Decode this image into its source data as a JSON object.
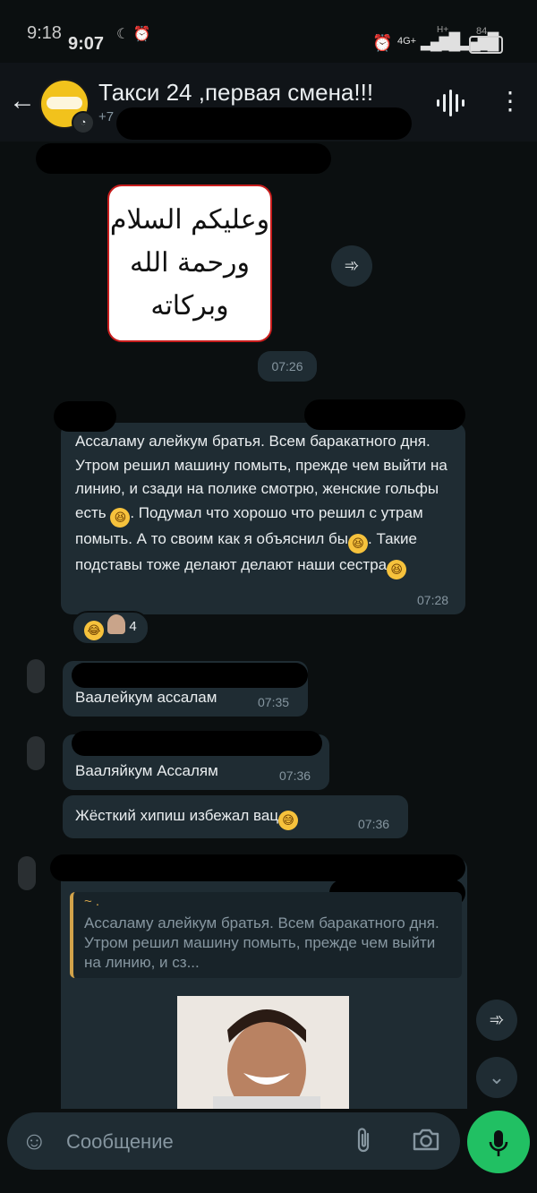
{
  "status_bar": {
    "time_back": "9:18",
    "time_front": "9:07",
    "net": "4G+",
    "net2": "H+",
    "battery_back": "84",
    "battery_front": "85"
  },
  "header": {
    "title": "Такси 24 ,первая смена!!!",
    "subtitle": "+7"
  },
  "messages": {
    "sticker_text": "وعليكم السلام ورحمة الله وبركاته",
    "sticker_time": "07:26",
    "msg1_text": "Ассаламу алейкум братья. Всем баракатного дня. Утром решил машину помыть, прежде чем выйти на линию, и сзади на полике смотрю, женские гольфы есть",
    "msg1_text_b": ". Подумал что хорошо что решил с утрам помыть. А то своим как я объяснил бы",
    "msg1_text_c": ". Такие подставы тоже делают делают наши сестра",
    "msg1_time": "07:28",
    "reaction_count": "4",
    "msg2_text": "Ваалейкум ассалам",
    "msg2_time": "07:35",
    "msg3_text": "Вааляйкум Ассалям",
    "msg3_time": "07:36",
    "msg4_text": "Жёсткий хипиш избежал вац",
    "msg4_time": "07:36",
    "quote_author": "~ .",
    "quote_text": "Ассаламу алейкум братья. Всем баракатного дня. Утром решил машину помыть, прежде чем выйти на линию, и сз..."
  },
  "input": {
    "placeholder": "Сообщение"
  },
  "icons": {
    "back": "arrow-left-icon",
    "voice": "waveform-icon",
    "menu": "more-vert-icon",
    "forward": "forward-icon",
    "scroll": "chevron-down-double-icon",
    "emoji": "emoji-icon",
    "attach": "paperclip-icon",
    "camera": "camera-icon",
    "mic": "mic-icon"
  },
  "colors": {
    "background": "#0b0f10",
    "bubble": "#1f2c33",
    "accent": "#21c063"
  }
}
